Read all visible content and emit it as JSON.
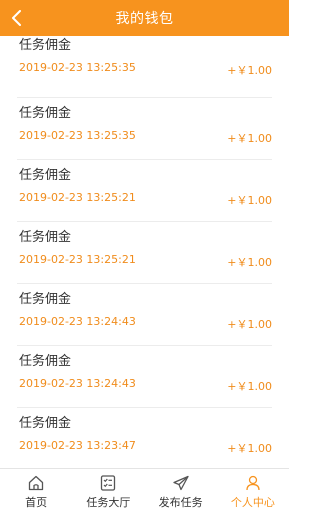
{
  "header": {
    "title": "我的钱包",
    "back_icon": "chevron-left-icon"
  },
  "colors": {
    "accent": "#f7931e",
    "amount": "#f08c1c",
    "text": "#333333"
  },
  "records": [
    {
      "title": "任务佣金",
      "time": "2019-02-23 13:25:35",
      "amount": "+￥1.00"
    },
    {
      "title": "任务佣金",
      "time": "2019-02-23 13:25:35",
      "amount": "+￥1.00"
    },
    {
      "title": "任务佣金",
      "time": "2019-02-23 13:25:21",
      "amount": "+￥1.00"
    },
    {
      "title": "任务佣金",
      "time": "2019-02-23 13:25:21",
      "amount": "+￥1.00"
    },
    {
      "title": "任务佣金",
      "time": "2019-02-23 13:24:43",
      "amount": "+￥1.00"
    },
    {
      "title": "任务佣金",
      "time": "2019-02-23 13:24:43",
      "amount": "+￥1.00"
    },
    {
      "title": "任务佣金",
      "time": "2019-02-23 13:23:47",
      "amount": "+￥1.00"
    }
  ],
  "tabbar": {
    "items": [
      {
        "label": "首页",
        "icon": "home-icon",
        "active": false
      },
      {
        "label": "任务大厅",
        "icon": "task-list-icon",
        "active": false
      },
      {
        "label": "发布任务",
        "icon": "paper-plane-icon",
        "active": false
      },
      {
        "label": "个人中心",
        "icon": "user-icon",
        "active": true
      }
    ]
  }
}
